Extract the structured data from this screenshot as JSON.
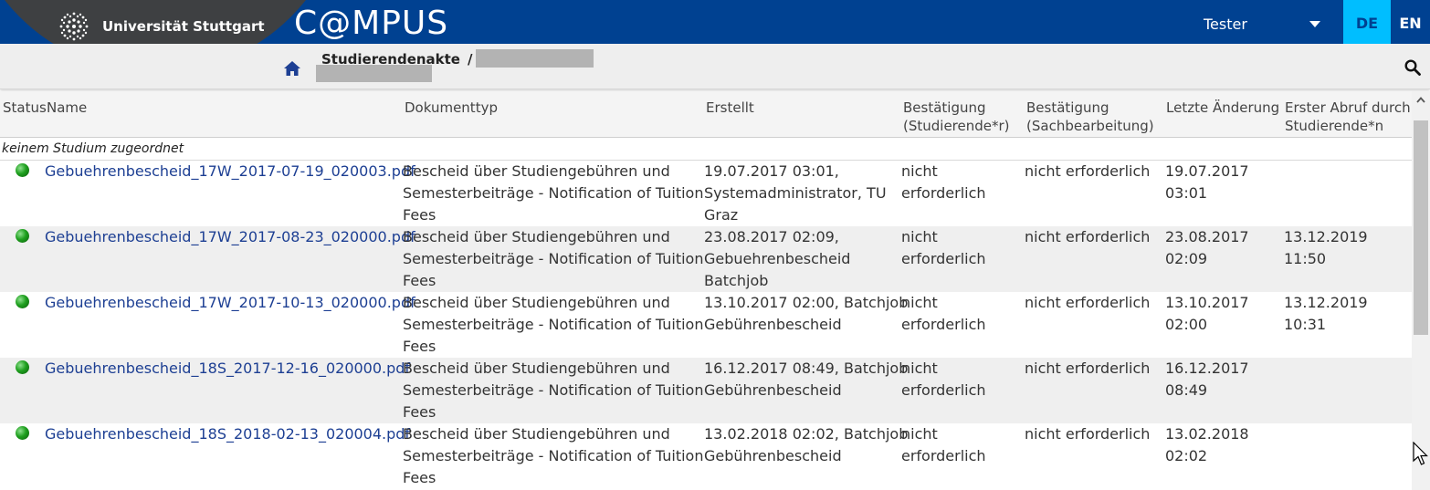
{
  "header": {
    "university_name": "Universität Stuttgart",
    "app_title": "C@MPUS",
    "user_name": "Tester",
    "lang_de": "DE",
    "lang_en": "EN",
    "brand_color": "#004191",
    "accent_color": "#00beff"
  },
  "breadcrumb": {
    "title": "Studierendenakte",
    "separator": "/"
  },
  "table": {
    "columns": {
      "status": "Status",
      "name": "Name",
      "doctype": "Dokumenttyp",
      "created": "Erstellt",
      "confirm_student_1": "Bestätigung",
      "confirm_student_2": "(Studierende*r)",
      "confirm_admin_1": "Bestätigung",
      "confirm_admin_2": "(Sachbearbeitung)",
      "last_change": "Letzte Änderung",
      "first_access_1": "Erster Abruf durch",
      "first_access_2": "Studierende*n"
    },
    "group_label": "keinem Studium zugeordnet",
    "rows": [
      {
        "name": "Gebuehrenbescheid_17W_2017-07-19_020003.pdf",
        "doctype_1": "Bescheid über Studiengebühren und",
        "doctype_2": "Semesterbeiträge - Notification of Tuition",
        "doctype_3": "Fees",
        "created_1": "19.07.2017 03:01,",
        "created_2": "Systemadministrator, TU",
        "created_3": "Graz",
        "confirm_student_1": "nicht",
        "confirm_student_2": "erforderlich",
        "confirm_admin": "nicht erforderlich",
        "last_change_1": "19.07.2017",
        "last_change_2": "03:01",
        "first_access": ""
      },
      {
        "name": "Gebuehrenbescheid_17W_2017-08-23_020000.pdf",
        "doctype_1": "Bescheid über Studiengebühren und",
        "doctype_2": "Semesterbeiträge - Notification of Tuition",
        "doctype_3": "Fees",
        "created_1": "23.08.2017 02:09,",
        "created_2": "Gebuehrenbescheid",
        "created_3": "Batchjob",
        "confirm_student_1": "nicht",
        "confirm_student_2": "erforderlich",
        "confirm_admin": "nicht erforderlich",
        "last_change_1": "23.08.2017",
        "last_change_2": "02:09",
        "first_access": "13.12.2019 11:50"
      },
      {
        "name": "Gebuehrenbescheid_17W_2017-10-13_020000.pdf",
        "doctype_1": "Bescheid über Studiengebühren und",
        "doctype_2": "Semesterbeiträge - Notification of Tuition",
        "doctype_3": "Fees",
        "created_1": "13.10.2017 02:00, Batchjob",
        "created_2": "Gebührenbescheid",
        "created_3": "",
        "confirm_student_1": "nicht",
        "confirm_student_2": "erforderlich",
        "confirm_admin": "nicht erforderlich",
        "last_change_1": "13.10.2017",
        "last_change_2": "02:00",
        "first_access": "13.12.2019 10:31"
      },
      {
        "name": "Gebuehrenbescheid_18S_2017-12-16_020000.pdf",
        "doctype_1": "Bescheid über Studiengebühren und",
        "doctype_2": "Semesterbeiträge - Notification of Tuition",
        "doctype_3": "Fees",
        "created_1": "16.12.2017 08:49, Batchjob",
        "created_2": "Gebührenbescheid",
        "created_3": "",
        "confirm_student_1": "nicht",
        "confirm_student_2": "erforderlich",
        "confirm_admin": "nicht erforderlich",
        "last_change_1": "16.12.2017",
        "last_change_2": "08:49",
        "first_access": ""
      },
      {
        "name": "Gebuehrenbescheid_18S_2018-02-13_020004.pdf",
        "doctype_1": "Bescheid über Studiengebühren und",
        "doctype_2": "Semesterbeiträge - Notification of Tuition",
        "doctype_3": "Fees",
        "created_1": "13.02.2018 02:02, Batchjob",
        "created_2": "Gebührenbescheid",
        "created_3": "",
        "confirm_student_1": "nicht",
        "confirm_student_2": "erforderlich",
        "confirm_admin": "nicht erforderlich",
        "last_change_1": "13.02.2018",
        "last_change_2": "02:02",
        "first_access": ""
      }
    ]
  },
  "icons": {
    "home": "home-icon",
    "search": "search-icon",
    "status": "status-green-icon"
  }
}
